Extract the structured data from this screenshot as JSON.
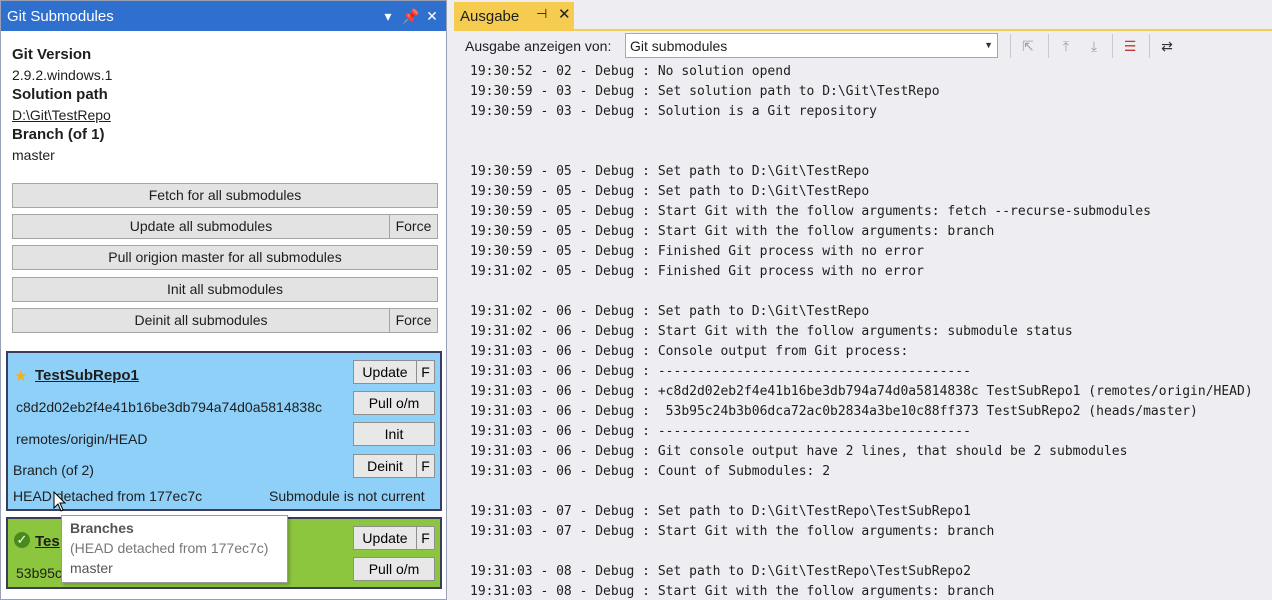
{
  "left_panel": {
    "title": "Git Submodules",
    "info": {
      "git_version_label": "Git Version",
      "git_version_value": "2.9.2.windows.1",
      "solution_path_label": "Solution path",
      "solution_path_value": "D:\\Git\\TestRepo",
      "branch_label": "Branch (of 1)",
      "branch_value": "master"
    },
    "buttons": {
      "fetch_all": "Fetch for all submodules",
      "update_all": "Update all submodules",
      "force": "Force",
      "pull_all": "Pull origion master for all submodules",
      "init_all": "Init all submodules",
      "deinit_all": "Deinit all submodules"
    },
    "submodules": [
      {
        "name": "TestSubRepo1",
        "hash": "c8d2d02eb2f4e41b16be3db794a74d0a5814838c",
        "remote": "remotes/origin/HEAD",
        "branch_label": "Branch (of 2)",
        "head_status": "HEAD detached from 177ec7c",
        "status": "Submodule is not current",
        "update": "Update",
        "force_short": "F",
        "pull": "Pull o/m",
        "init": "Init",
        "deinit": "Deinit",
        "color": "#8fd0f8"
      },
      {
        "name": "Tes",
        "hash": "53b95c",
        "update": "Update",
        "force_short": "F",
        "pull": "Pull o/m",
        "color": "#8cc63f"
      }
    ],
    "tooltip": {
      "title": "Branches",
      "line1": "(HEAD detached from 177ec7c)",
      "line2": "master"
    }
  },
  "right_panel": {
    "tab_label": "Ausgabe",
    "show_output_label": "Ausgabe anzeigen von:",
    "source_selected": "Git submodules",
    "accent": "#f5cc4f",
    "output_lines": [
      "19:30:52 - 02 - Debug : No solution opend",
      "19:30:59 - 03 - Debug : Set solution path to D:\\Git\\TestRepo",
      "19:30:59 - 03 - Debug : Solution is a Git repository",
      "",
      "",
      "19:30:59 - 05 - Debug : Set path to D:\\Git\\TestRepo",
      "19:30:59 - 05 - Debug : Set path to D:\\Git\\TestRepo",
      "19:30:59 - 05 - Debug : Start Git with the follow arguments: fetch --recurse-submodules",
      "19:30:59 - 05 - Debug : Start Git with the follow arguments: branch",
      "19:30:59 - 05 - Debug : Finished Git process with no error",
      "19:31:02 - 05 - Debug : Finished Git process with no error",
      "",
      "19:31:02 - 06 - Debug : Set path to D:\\Git\\TestRepo",
      "19:31:02 - 06 - Debug : Start Git with the follow arguments: submodule status",
      "19:31:03 - 06 - Debug : Console output from Git process:",
      "19:31:03 - 06 - Debug : ----------------------------------------",
      "19:31:03 - 06 - Debug : +c8d2d02eb2f4e41b16be3db794a74d0a5814838c TestSubRepo1 (remotes/origin/HEAD)",
      "19:31:03 - 06 - Debug :  53b95c24b3b06dca72ac0b2834a3be10c88ff373 TestSubRepo2 (heads/master)",
      "19:31:03 - 06 - Debug : ----------------------------------------",
      "19:31:03 - 06 - Debug : Git console output have 2 lines, that should be 2 submodules",
      "19:31:03 - 06 - Debug : Count of Submodules: 2",
      "",
      "19:31:03 - 07 - Debug : Set path to D:\\Git\\TestRepo\\TestSubRepo1",
      "19:31:03 - 07 - Debug : Start Git with the follow arguments: branch",
      "",
      "19:31:03 - 08 - Debug : Set path to D:\\Git\\TestRepo\\TestSubRepo2",
      "19:31:03 - 08 - Debug : Start Git with the follow arguments: branch"
    ]
  }
}
